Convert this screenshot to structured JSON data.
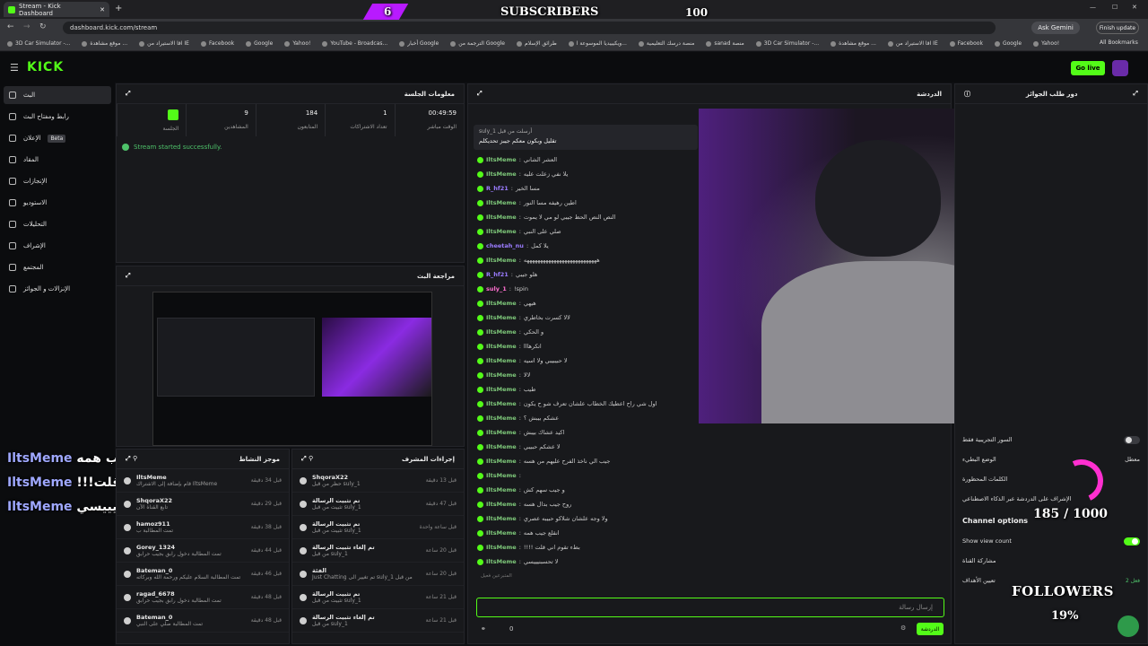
{
  "browser": {
    "tab_title": "Stream - Kick Dashboard",
    "url": "dashboard.kick.com/stream",
    "ask_gemini": "Ask Gemini",
    "finish_update": "Finish update",
    "all_bookmarks": "All Bookmarks",
    "bookmarks": [
      "3D Car Simulator -...",
      "موقع مشاهدة ...",
      "اقا الاستيراد من IE",
      "Facebook",
      "Google",
      "Yahoo!",
      "YouTube - Broadcas...",
      "أخبار Google",
      "الترجمة من Google",
      "طرائق الإسلام",
      "ويكيبيديا الموسوعة ا...",
      "منصة درسك التعليمية",
      "sanad منصة",
      "3D Car Simulator -...",
      "موقع مشاهدة ...",
      "اقا الاستيراد من IE",
      "Facebook",
      "Google",
      "Yahoo!"
    ]
  },
  "stream_overlay": {
    "sub_count_left": "6",
    "subscribers_label": "SUBSCRIBERS",
    "sub_goal": "100",
    "followers_count": "185 / 1000",
    "followers_label": "FOLLOWERS",
    "followers_pct": "19%",
    "chat": [
      {
        "user": "IltsMeme",
        "text": "انقلع جيب همه"
      },
      {
        "user": "IltsMeme",
        "text": "!!!بطء تقوم اني قلت"
      },
      {
        "user": "IltsMeme",
        "text": "لاتحسبنيييسي"
      }
    ]
  },
  "kick": {
    "logo": "KICK",
    "go_live": "Go live"
  },
  "sidebar": {
    "items": [
      {
        "label": "البث",
        "active": true
      },
      {
        "label": "رابط ومفتاح البث"
      },
      {
        "label": "الإعلان",
        "badge": "Beta"
      },
      {
        "label": "المقاد"
      },
      {
        "label": "الإنجازات"
      },
      {
        "label": "الاستوديو"
      },
      {
        "label": "التحليلات"
      },
      {
        "label": "الإشراف"
      },
      {
        "label": "المجتمع"
      },
      {
        "label": "الإنزالات و الجوائز"
      }
    ]
  },
  "session": {
    "title": "معلومات الجلسة",
    "stats": [
      {
        "value": "00:49:59",
        "label": "الوقت مباشر"
      },
      {
        "value": "1",
        "label": "تعداد الاشتراكات"
      },
      {
        "value": "184",
        "label": "المتابعون"
      },
      {
        "value": "9",
        "label": "المشاهدين"
      },
      {
        "value": "",
        "label": "الجلسة"
      }
    ],
    "status": "Stream started successfully."
  },
  "preview": {
    "title": "مراجعة البث"
  },
  "chat": {
    "title": "الدردشة",
    "pinned_by": "suly_1 أرسلت من قبل",
    "pinned_text": "تقليل وبكون معكم جيبز تحديكلم",
    "messages": [
      {
        "user": "IltsMeme",
        "text": "العشر الشاني"
      },
      {
        "user": "IltsMeme",
        "text": "يلا نفي زعلت عليه"
      },
      {
        "user": "R_hf21",
        "text": "مسا الخير"
      },
      {
        "user": "IltsMeme",
        "text": "اطين رهيفه مسا النور"
      },
      {
        "user": "IltsMeme",
        "text": "النص النص الحظ جيبي لو مي لا يموت"
      },
      {
        "user": "IltsMeme",
        "text": "صلي على النبي"
      },
      {
        "user": "cheetah_nu",
        "text": "يلا كمل"
      },
      {
        "user": "IltsMeme",
        "text": "هههههههههههههههههههههههههههه"
      },
      {
        "user": "R_hf21",
        "text": "هلو جيبي"
      },
      {
        "user": "suly_1",
        "text": "!spin"
      },
      {
        "user": "IltsMeme",
        "text": "هيهي"
      },
      {
        "user": "IltsMeme",
        "text": "لالا كسرت بخاطري"
      },
      {
        "user": "IltsMeme",
        "text": "و الحكي"
      },
      {
        "user": "IltsMeme",
        "text": "اتكرهااا"
      },
      {
        "user": "IltsMeme",
        "text": "لا حبيبيبي ولا اسيه"
      },
      {
        "user": "IltsMeme",
        "text": "لالا"
      },
      {
        "user": "IltsMeme",
        "text": "طيب"
      },
      {
        "user": "IltsMeme",
        "text": "اول شي راح اعطيك الخطاب علشان تعرف شو ح يكون"
      },
      {
        "user": "IltsMeme",
        "text": "عشكم بيبش ؟"
      },
      {
        "user": "IltsMeme",
        "text": "اكيد عشاك بيبش"
      },
      {
        "user": "IltsMeme",
        "text": "لا عشكم حبيبي"
      },
      {
        "user": "IltsMeme",
        "text": "جيب الي ناخذ الفرح عليهم من هسه"
      },
      {
        "user": "IltsMeme",
        "text": ""
      },
      {
        "user": "IltsMeme",
        "text": "و جيب سهم كش"
      },
      {
        "user": "IltsMeme",
        "text": "روح جيب بدال هسه"
      },
      {
        "user": "IltsMeme",
        "text": "ولا وجه علشان شلاكو حبيبه عصري"
      },
      {
        "user": "IltsMeme",
        "text": "انقلع جيب همه"
      },
      {
        "user": "IltsMeme",
        "text": "!!!! بطء تقوم اني قلت"
      },
      {
        "user": "IltsMeme",
        "text": "لا تحسبنيييسي"
      }
    ],
    "input_placeholder": "إرسال رسالة",
    "send_label": "الدردشة",
    "viewer_count": "0",
    "goals_label": "المتبرعين فعيل"
  },
  "queue": {
    "title": "دور طلب الجوائز",
    "settings": [
      {
        "label": "السور التجريبية فقط",
        "value": ""
      },
      {
        "label": "الوضع البطيء",
        "value": "معطل"
      },
      {
        "label": "الكلمات المحظورة",
        "value": ""
      },
      {
        "label": "الإشراف على الدردشة عبر الذكاء الاصطناعي",
        "value": ""
      }
    ],
    "channel_options": "Channel options",
    "show_view_count": "Show view count",
    "channel_share": "مشاركة القناة",
    "targets_label": "تعيين الأهداف",
    "targets_value": "فعل 2"
  },
  "mod_actions": {
    "title": "إجراءات المشرف",
    "rows": [
      {
        "name": "ShqoraX22",
        "sub": "حظر من قبل suly_1",
        "time": "قبل 13 دقيقة"
      },
      {
        "name": "تم تثبيت الرسالة",
        "sub": "تثبيت من قبل suly_1",
        "time": "قبل 47 دقيقة"
      },
      {
        "name": "تم تثبيت الرسالة",
        "sub": "تثبيت من قبل suly_1",
        "time": "قبل ساعة واحدة"
      },
      {
        "name": "تم إلغاء تثبيت الرسالة",
        "sub": "من قبل suly_1",
        "time": "قبل 20 ساعة"
      },
      {
        "name": "الفئة",
        "sub": "Just Chatting تم تغيير الى suly_1 من قبل",
        "time": "قبل 20 ساعة"
      },
      {
        "name": "تم تثبيت الرسالة",
        "sub": "تثبيت من قبل suly_1",
        "time": "قبل 21 ساعة"
      },
      {
        "name": "تم إلغاء تثبيت الرسالة",
        "sub": "من قبل suly_1",
        "time": "قبل 21 ساعة"
      }
    ]
  },
  "activity": {
    "title": "موجز النشاط",
    "rows": [
      {
        "name": "IltsMeme",
        "sub": "قام بإضافة إلى الاشتراك IltsMeme",
        "time": "قبل 34 دقيقة"
      },
      {
        "name": "ShqoraX22",
        "sub": "تابع القناة الآن",
        "time": "قبل 29 دقيقة"
      },
      {
        "name": "hamoz911",
        "sub": "تمت المطالبة ب",
        "time": "قبل 38 دقيقة"
      },
      {
        "name": "Gorey_1324",
        "sub": "تمت المطالبة دخول رابق بجيب حرابق",
        "time": "قبل 44 دقيقة"
      },
      {
        "name": "Bateman_0",
        "sub": "تمت المطالبة السلام عليكم ورحمة الله وبركاته",
        "time": "قبل 46 دقيقة"
      },
      {
        "name": "ragad_6678",
        "sub": "تمت المطالبة دخول رابق بجيب حرابق",
        "time": "قبل 48 دقيقة"
      },
      {
        "name": "Bateman_0",
        "sub": "تمت المطالبة صلي على النبي",
        "time": "قبل 48 دقيقة"
      }
    ]
  }
}
